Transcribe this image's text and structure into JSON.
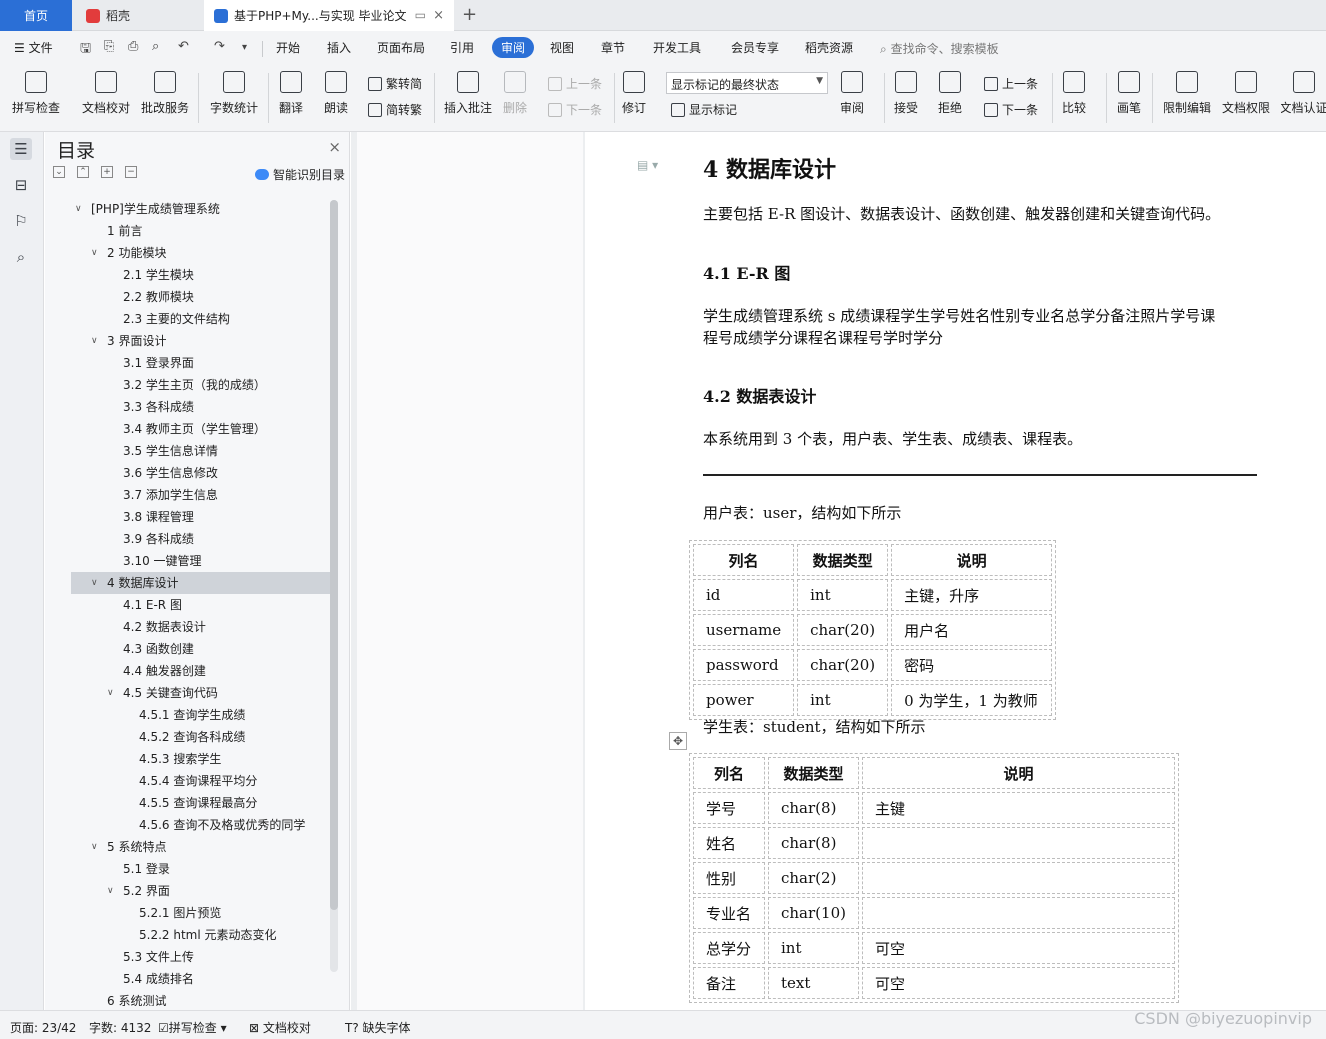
{
  "tabs": {
    "home": "首页",
    "wps": "稻壳",
    "doc": "基于PHP+My...与实现 毕业论文",
    "accent": "#2b6fd6"
  },
  "menu": {
    "file": "文件",
    "items": [
      "开始",
      "插入",
      "页面布局",
      "引用",
      "审阅",
      "视图",
      "章节",
      "开发工具",
      "会员专享",
      "稻壳资源"
    ],
    "active": "审阅",
    "search": "查找命令、搜索模板"
  },
  "ribbon": {
    "spell": "拼写检查",
    "proof": "文档校对",
    "batch": "批改服务",
    "wordcount": "字数统计",
    "translate": "翻译",
    "read": "朗读",
    "trad": "繁转简",
    "simp": "简转繁",
    "comment": "插入批注",
    "delete": "删除",
    "prev_comment": "上一条",
    "next_comment": "下一条",
    "track": "修订",
    "markstate": "显示标记的最终状态",
    "showmark": "显示标记",
    "review": "审阅",
    "accept": "接受",
    "reject": "拒绝",
    "prev": "上一条",
    "next": "下一条",
    "compare": "比较",
    "pen": "画笔",
    "restrict": "限制编辑",
    "perm": "文档权限",
    "cert": "文档认证"
  },
  "toc": {
    "title": "目录",
    "smart": "智能识别目录",
    "items": [
      {
        "label": "[PHP]学生成绩管理系统",
        "level": 0,
        "toggle": true
      },
      {
        "label": "1  前言",
        "level": 1,
        "toggle": false
      },
      {
        "label": "2  功能模块",
        "level": 1,
        "toggle": true
      },
      {
        "label": "2.1 学生模块",
        "level": 2,
        "toggle": false
      },
      {
        "label": "2.2  教师模块",
        "level": 2,
        "toggle": false
      },
      {
        "label": "2.3  主要的文件结构",
        "level": 2,
        "toggle": false
      },
      {
        "label": "3  界面设计",
        "level": 1,
        "toggle": true
      },
      {
        "label": "3.1  登录界面",
        "level": 2,
        "toggle": false
      },
      {
        "label": "3.2  学生主页（我的成绩）",
        "level": 2,
        "toggle": false
      },
      {
        "label": "3.3  各科成绩",
        "level": 2,
        "toggle": false
      },
      {
        "label": "3.4  教师主页（学生管理）",
        "level": 2,
        "toggle": false
      },
      {
        "label": "3.5  学生信息详情",
        "level": 2,
        "toggle": false
      },
      {
        "label": "3.6  学生信息修改",
        "level": 2,
        "toggle": false
      },
      {
        "label": "3.7  添加学生信息",
        "level": 2,
        "toggle": false
      },
      {
        "label": "3.8  课程管理",
        "level": 2,
        "toggle": false
      },
      {
        "label": "3.9  各科成绩",
        "level": 2,
        "toggle": false
      },
      {
        "label": "3.10  一键管理",
        "level": 2,
        "toggle": false
      },
      {
        "label": "4  数据库设计",
        "level": 1,
        "toggle": true,
        "selected": true
      },
      {
        "label": "4.1 E-R 图",
        "level": 2,
        "toggle": false
      },
      {
        "label": "4.2  数据表设计",
        "level": 2,
        "toggle": false
      },
      {
        "label": "4.3  函数创建",
        "level": 2,
        "toggle": false
      },
      {
        "label": "4.4  触发器创建",
        "level": 2,
        "toggle": false
      },
      {
        "label": "4.5  关键查询代码",
        "level": 2,
        "toggle": true
      },
      {
        "label": "4.5.1  查询学生成绩",
        "level": 3,
        "toggle": false
      },
      {
        "label": "4.5.2  查询各科成绩",
        "level": 3,
        "toggle": false
      },
      {
        "label": "4.5.3  搜索学生",
        "level": 3,
        "toggle": false
      },
      {
        "label": "4.5.4  查询课程平均分",
        "level": 3,
        "toggle": false
      },
      {
        "label": "4.5.5  查询课程最高分",
        "level": 3,
        "toggle": false
      },
      {
        "label": "4.5.6  查询不及格或优秀的同学",
        "level": 3,
        "toggle": false
      },
      {
        "label": "5  系统特点",
        "level": 1,
        "toggle": true
      },
      {
        "label": "5.1  登录",
        "level": 2,
        "toggle": false
      },
      {
        "label": "5.2  界面",
        "level": 2,
        "toggle": true
      },
      {
        "label": "5.2.1  图片预览",
        "level": 3,
        "toggle": false
      },
      {
        "label": "5.2.2 html 元素动态变化",
        "level": 3,
        "toggle": false
      },
      {
        "label": "5.3  文件上传",
        "level": 2,
        "toggle": false
      },
      {
        "label": "5.4  成绩排名",
        "level": 2,
        "toggle": false
      },
      {
        "label": "6  系统测试",
        "level": 1,
        "toggle": false
      }
    ]
  },
  "doc": {
    "h1": "4  数据库设计",
    "intro": "主要包括 E-R 图设计、数据表设计、函数创建、触发器创建和关键查询代码。",
    "h41": "4.1 E-R 图",
    "er_line1": "学生成绩管理系统 s 成绩课程学生学号姓名性别专业名总学分备注照片学号课",
    "er_line2": "程号成绩学分课程名课程号学时学分",
    "h42": "4.2  数据表设计",
    "tables_intro": "本系统用到 3 个表，用户表、学生表、成绩表、课程表。",
    "user_caption": "用户表：user，结构如下所示",
    "user_table": {
      "headers": [
        "列名",
        "数据类型",
        "说明"
      ],
      "rows": [
        [
          "id",
          "int",
          "主键，升序"
        ],
        [
          "username",
          "char(20)",
          "用户名"
        ],
        [
          "password",
          "char(20)",
          "密码"
        ],
        [
          "power",
          "int",
          "0 为学生，1 为教师"
        ]
      ]
    },
    "student_caption": "学生表：student，结构如下所示",
    "student_table": {
      "headers": [
        "列名",
        "数据类型",
        "说明"
      ],
      "rows": [
        [
          "学号",
          "char(8)",
          "主键"
        ],
        [
          "姓名",
          "char(8)",
          ""
        ],
        [
          "性别",
          "char(2)",
          ""
        ],
        [
          "专业名",
          "char(10)",
          ""
        ],
        [
          "总学分",
          "int",
          "可空"
        ],
        [
          "备注",
          "text",
          "可空"
        ]
      ]
    }
  },
  "status": {
    "page": "页面: 23/42",
    "words": "字数: 4132",
    "spell": "拼写检查",
    "proof": "文档校对",
    "font": "缺失字体"
  },
  "watermark": "CSDN @biyezuopinvip"
}
